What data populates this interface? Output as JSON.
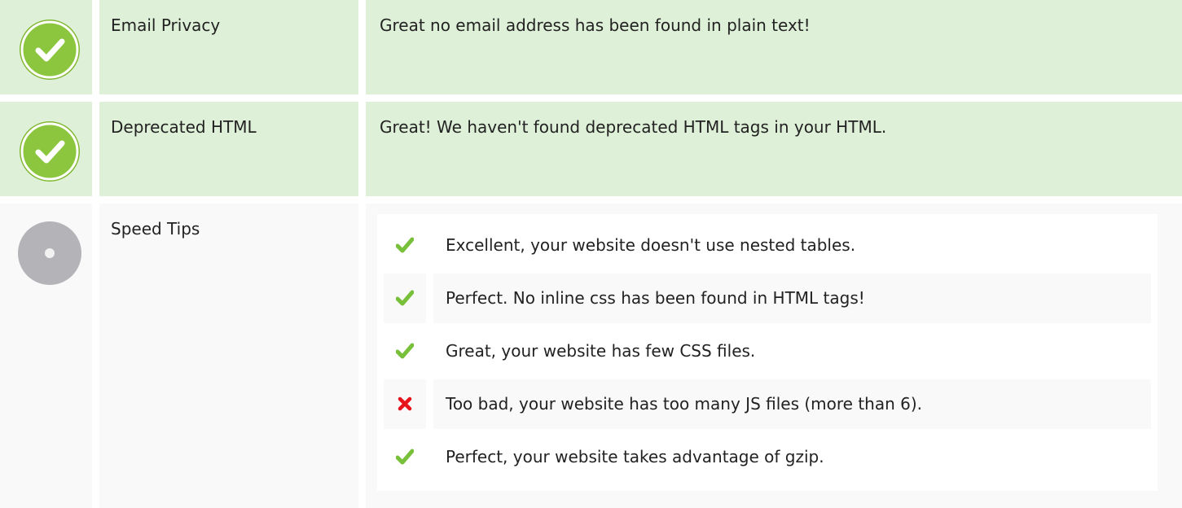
{
  "colors": {
    "pass_background": "#dff0d8",
    "neutral_background": "#f9f9f9",
    "pass_icon": "#8cc63f",
    "neutral_icon": "#b4b4b8",
    "check_mark": "#78bf3a",
    "cross_mark": "#e8141b"
  },
  "rows": [
    {
      "status": "pass",
      "status_icon": "check-circle-icon",
      "label": "Email Privacy",
      "message": "Great no email address has been found in plain text!"
    },
    {
      "status": "pass",
      "status_icon": "check-circle-icon",
      "label": "Deprecated HTML",
      "message": "Great! We haven't found deprecated HTML tags in your HTML."
    },
    {
      "status": "neutral",
      "status_icon": "info-circle-icon",
      "label": "Speed Tips",
      "tips": [
        {
          "icon": "check-icon",
          "text": "Excellent, your website doesn't use nested tables."
        },
        {
          "icon": "check-icon",
          "text": "Perfect. No inline css has been found in HTML tags!"
        },
        {
          "icon": "check-icon",
          "text": "Great, your website has few CSS files."
        },
        {
          "icon": "cross-icon",
          "text": "Too bad, your website has too many JS files (more than 6)."
        },
        {
          "icon": "check-icon",
          "text": "Perfect, your website takes advantage of gzip."
        }
      ]
    }
  ]
}
